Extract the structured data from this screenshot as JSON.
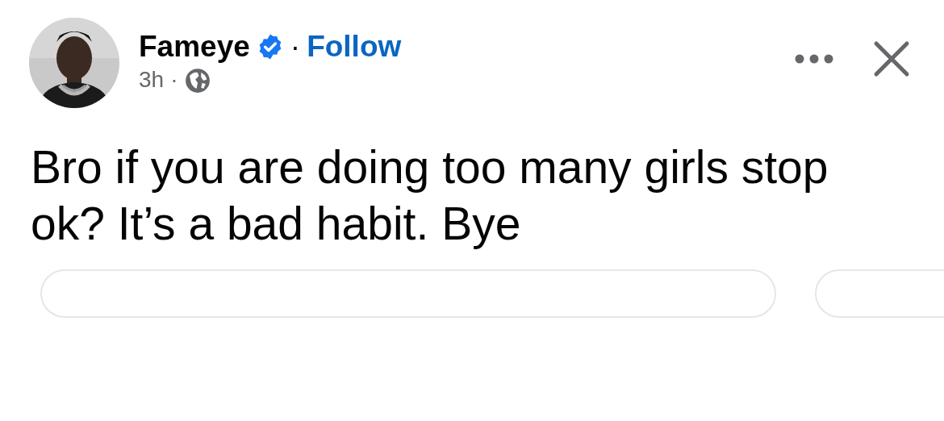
{
  "post": {
    "author": {
      "name": "Fameye",
      "verified": true,
      "separator": "·",
      "follow_label": "Follow"
    },
    "time": "3h",
    "time_separator": "·",
    "text": "Bro if you are doing too many girls stop ok? It’s a bad habit. Bye"
  }
}
